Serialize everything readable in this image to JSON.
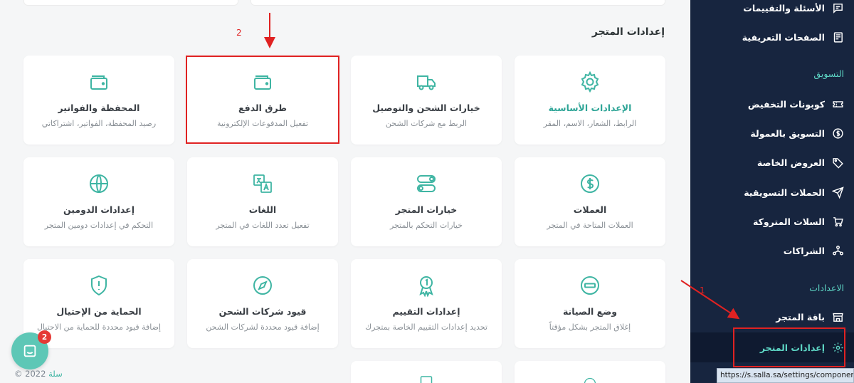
{
  "sidebar": {
    "items_top": [
      {
        "label": "الأسئلة والتقييمات",
        "icon": "message-square-icon"
      },
      {
        "label": "الصفحات التعريفية",
        "icon": "newspaper-icon"
      }
    ],
    "marketing_heading": "التسويق",
    "marketing_items": [
      {
        "label": "كوبونات التخفيض",
        "icon": "ticket-icon"
      },
      {
        "label": "التسويق بالعمولة",
        "icon": "dollar-circle-icon"
      },
      {
        "label": "العروض الخاصة",
        "icon": "tag-icon"
      },
      {
        "label": "الحملات التسويقية",
        "icon": "send-icon"
      },
      {
        "label": "السلات المتروكة",
        "icon": "cart-icon"
      },
      {
        "label": "الشراكات",
        "icon": "partners-icon"
      }
    ],
    "settings_heading": "الاعدادات",
    "settings_items": [
      {
        "label": "باقة المتجر",
        "icon": "store-icon"
      },
      {
        "label": "إعدادات المتجر",
        "icon": "gear-icon",
        "active": true
      }
    ]
  },
  "status_bar": {
    "url": "https://s.salla.sa/settings/component/ba"
  },
  "main": {
    "section_title": "إعدادات المتجر",
    "cards": [
      {
        "title": "الإعدادات الأساسية",
        "subtitle": "الرابط، الشعار، الاسم، المقر",
        "icon": "gear-icon",
        "accent": true
      },
      {
        "title": "خيارات الشحن والتوصيل",
        "subtitle": "الربط مع شركات الشحن",
        "icon": "truck-icon"
      },
      {
        "title": "طرق الدفع",
        "subtitle": "تفعيل المدفوعات الإلكترونية",
        "icon": "wallet-icon"
      },
      {
        "title": "المحفظة والفواتير",
        "subtitle": "رصيد المحفظة، الفواتير، اشتراكاتي",
        "icon": "wallet-icon"
      },
      {
        "title": "العملات",
        "subtitle": "العملات المتاحة في المتجر",
        "icon": "dollar-circle-icon"
      },
      {
        "title": "خيارات المتجر",
        "subtitle": "خيارات التحكم بالمتجر",
        "icon": "toggles-icon"
      },
      {
        "title": "اللغات",
        "subtitle": "تفعيل تعدد اللغات في المتجر",
        "icon": "translate-icon"
      },
      {
        "title": "إعدادات الدومين",
        "subtitle": "التحكم في إعدادات دومين المتجر",
        "icon": "globe-icon"
      },
      {
        "title": "وضع الصيانة",
        "subtitle": "إغلاق المتجر بشكل مؤقتاً",
        "icon": "minus-circle-icon"
      },
      {
        "title": "إعدادات التقييم",
        "subtitle": "تحديد إعدادات التقييم الخاصة بمتجرك",
        "icon": "award-icon"
      },
      {
        "title": "قيود شركات الشحن",
        "subtitle": "إضافة قيود محددة لشركات الشحن",
        "icon": "compass-icon"
      },
      {
        "title": "الحماية من الإحتيال",
        "subtitle": "إضافة قيود محددة للحماية من الاحتيال",
        "icon": "shield-alert-icon"
      }
    ]
  },
  "annotations": {
    "marker_1": "1",
    "marker_2": "2"
  },
  "chat": {
    "badge_count": "2"
  },
  "footer": {
    "year": "2022 ©",
    "brand": "سلة"
  },
  "colors": {
    "sidebar_bg": "#17253f",
    "accent": "#5dd5c4",
    "icon_teal": "#3fb5a3",
    "annotation_red": "#e02222"
  }
}
